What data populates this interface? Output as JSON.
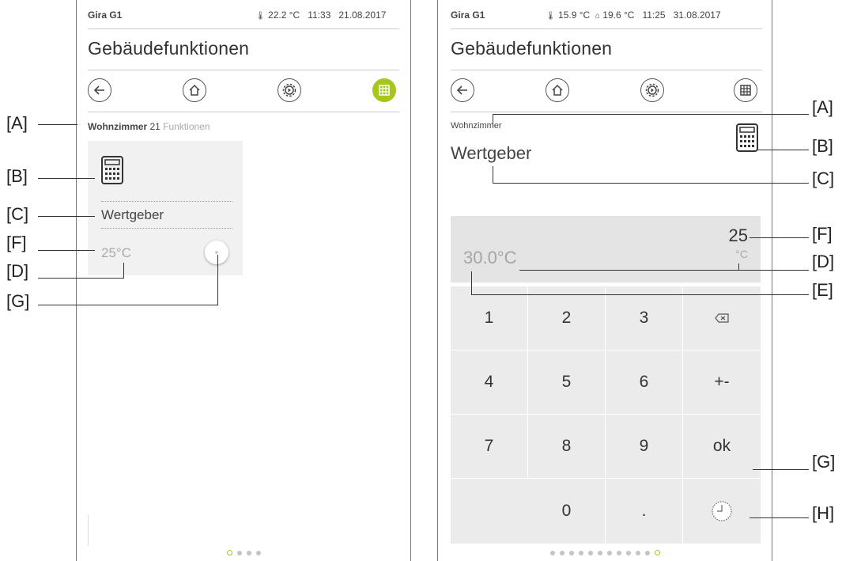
{
  "colors": {
    "accent": "#a5c61f",
    "key_bg": "#ebebeb",
    "display_bg": "#e4e4e4"
  },
  "left": {
    "status": {
      "device": "Gira G1",
      "temp": "22.2 °C",
      "time": "11:33",
      "date": "21.08.2017"
    },
    "title": "Gebäudefunktionen",
    "nav": [
      "back-icon",
      "home-icon",
      "settings-icon",
      "grid-icon"
    ],
    "breadcrumb": {
      "room": "Wohnzimmer",
      "count": "21",
      "suffix": "Funktionen"
    },
    "tile": {
      "icon": "calculator-icon",
      "name": "Wertgeber",
      "value": "25°C"
    },
    "pager": {
      "total": 4,
      "active": 0
    }
  },
  "right": {
    "status": {
      "device": "Gira G1",
      "outside_temp": "15.9 °C",
      "inside_temp": "19.6 °C",
      "time": "11:25",
      "date": "31.08.2017"
    },
    "title": "Gebäudefunktionen",
    "room": "Wohnzimmer",
    "name": "Wertgeber",
    "display": {
      "current": "30.0°C",
      "entry": "25",
      "unit": "°C"
    },
    "keys": [
      "1",
      "2",
      "3",
      "⌫",
      "4",
      "5",
      "6",
      "+-",
      "7",
      "8",
      "9",
      "ok",
      "",
      "0",
      ".",
      "clock-icon"
    ],
    "pager": {
      "total": 12,
      "active": 11
    }
  },
  "callouts": {
    "left": [
      "[A]",
      "[B]",
      "[C]",
      "[F]",
      "[D]",
      "[G]"
    ],
    "right": [
      "[A]",
      "[B]",
      "[C]",
      "[F]",
      "[D]",
      "[E]",
      "[G]",
      "[H]"
    ]
  }
}
